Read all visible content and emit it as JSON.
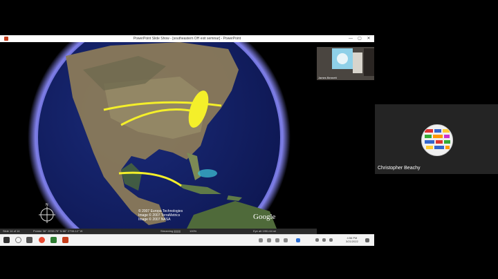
{
  "window": {
    "title": "PowerPoint Slide Show - [southeastern OH exit seminar] - PowerPoint",
    "minimize": "—",
    "maximize": "▢",
    "close": "✕"
  },
  "map": {
    "credits": [
      "© 2007 Europa Technologies",
      "Image © 2007 TerraMetrics",
      "Image © 2007 NASA"
    ],
    "brand": "Google",
    "compass_north": "N"
  },
  "status_bar": {
    "slide_info": "Slide 14 of 14",
    "pointer": "Pointer  36° 25'55.75\" N  86° 27'06.12\" W",
    "streaming": "Streaming |||||||||",
    "streaming_pct": "100%",
    "eye_alt": "Eye alt  1951.64 mi"
  },
  "taskbar": {
    "time": "4:56 PM",
    "date": "3/21/2022"
  },
  "presenter": {
    "name": "James Bennett"
  },
  "participant": {
    "name": "Christopher Beachy"
  }
}
